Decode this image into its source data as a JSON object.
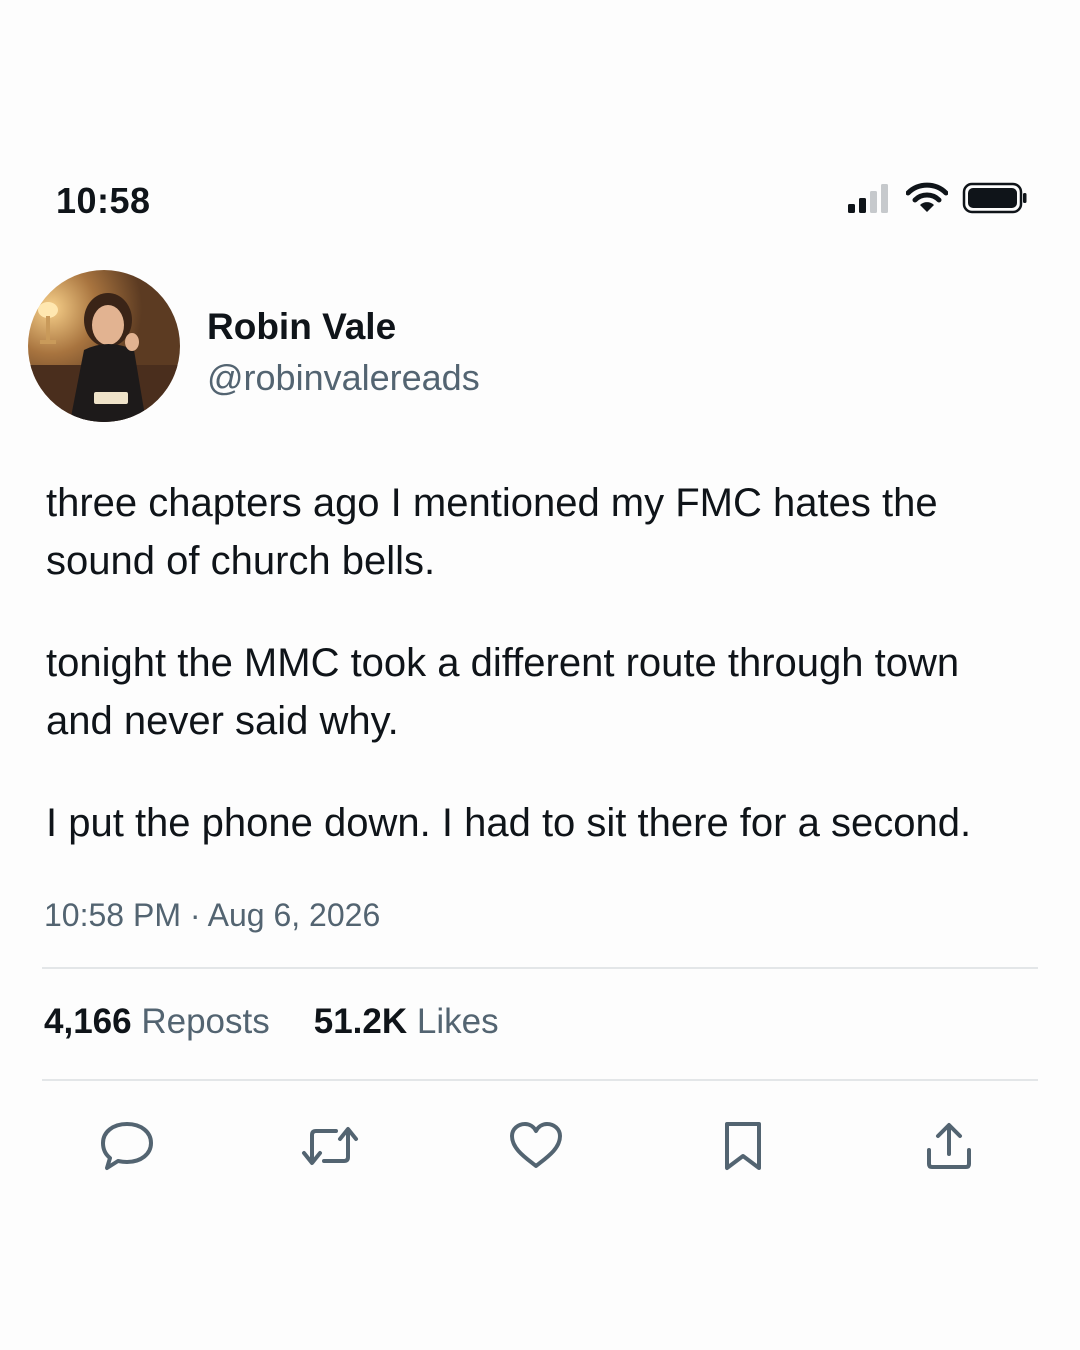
{
  "status_bar": {
    "time": "10:58",
    "icons": [
      "cellular-signal-icon",
      "wifi-icon",
      "battery-icon"
    ]
  },
  "post": {
    "author": {
      "display_name": "Robin Vale",
      "handle": "@robinvalereads"
    },
    "paragraphs": [
      [
        "three chapters ago I mentioned my FMC hates the",
        "sound of church bells."
      ],
      [
        "tonight the MMC took a different route through town",
        "and never said why."
      ],
      [
        "I put the phone down. I had to sit there for a second."
      ]
    ],
    "timestamp": "10:58 PM · Aug 6, 2026",
    "stats": {
      "reposts_count": "4,166",
      "reposts_label": "Reposts",
      "likes_count": "51.2K",
      "likes_label": "Likes"
    },
    "actions": [
      "reply-icon",
      "repost-icon",
      "like-icon",
      "bookmark-icon",
      "share-icon"
    ]
  },
  "colors": {
    "text": "#0f1419",
    "secondary_text": "#536471",
    "divider": "#e3e6e8",
    "background": "#fdfdfd"
  }
}
